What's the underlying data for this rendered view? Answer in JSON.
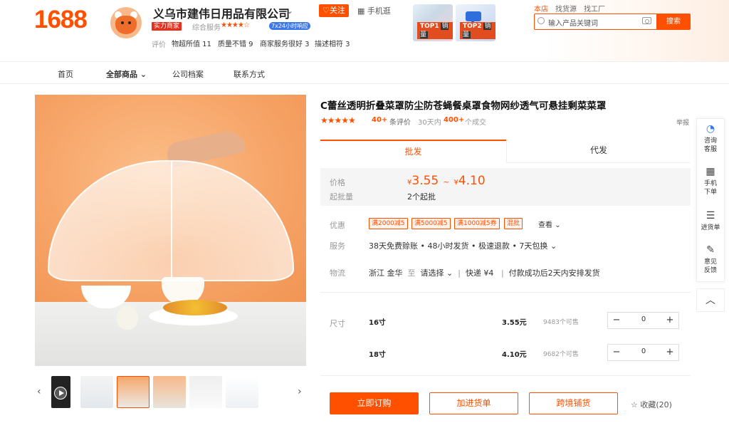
{
  "header": {
    "logo": "1688",
    "company_name": "义乌市建伟日用品有限公司",
    "follow_label": "♡关注",
    "mobile_link": "手机逛",
    "badge_strength": "实力商家",
    "service_label": "综合服务",
    "service_score": "4.5",
    "badge_24h": "7x24小时响应",
    "eval_label": "评价",
    "eval_items": [
      "物超所值 11",
      "质量不错 9",
      "商家服务很好 3",
      "描述相符 3"
    ],
    "top_products": [
      {
        "rank": "TOP1",
        "label": "销量"
      },
      {
        "rank": "TOP2",
        "label": "销量"
      }
    ],
    "search": {
      "scope_tabs": [
        "本店",
        "找货源",
        "找工厂"
      ],
      "active_scope": "本店",
      "placeholder": "输入产品关键词",
      "button": "搜索"
    }
  },
  "nav": {
    "items": [
      "首页",
      "全部商品",
      "公司档案",
      "联系方式"
    ]
  },
  "product": {
    "title": "C蕾丝透明折叠菜罩防尘防苍蝇餐桌罩食物网纱透气可悬挂剩菜菜罩",
    "rating_stars": "★★★★★",
    "rating_count": "40+",
    "rating_text": "条评价",
    "sales_text": "30天内",
    "sales_num": "400+",
    "sales_unit": "个成交",
    "report": "举报",
    "tabs": [
      "批发",
      "代发"
    ],
    "price_label": "价格",
    "currency": "¥",
    "price_min": "3.55",
    "price_max": "4.10",
    "moq_label": "起批量",
    "moq_value": "2个起批",
    "promo_label": "优惠",
    "promos": [
      "满2000减5",
      "满5000减5",
      "满1000减5券",
      "混批"
    ],
    "view_more": "查看",
    "service_label": "服务",
    "service_text": "38天免费赊账 • 48小时发货 • 极速退款 • 7天包换",
    "logistics_label": "物流",
    "logistics_from": "浙江 金华",
    "logistics_to_word": "至",
    "logistics_select": "请选择",
    "logistics_express": "快递 ¥4",
    "logistics_note": "付款成功后2天内安排发货",
    "size_label": "尺寸",
    "skus": [
      {
        "name": "16寸",
        "price": "3.55元",
        "stock": "9483个可售",
        "qty": "0"
      },
      {
        "name": "18寸",
        "price": "4.10元",
        "stock": "9682个可售",
        "qty": "0"
      }
    ],
    "buttons": {
      "buy": "立即订购",
      "cart": "加进货单",
      "cross": "跨境铺货",
      "favorite": "☆ 收藏(20)"
    }
  },
  "sidebar": {
    "items": [
      {
        "label1": "咨询",
        "label2": "客服",
        "icon": "chat-icon"
      },
      {
        "label1": "手机",
        "label2": "下单",
        "icon": "qr-icon"
      },
      {
        "label1": "进货单",
        "label2": "",
        "icon": "list-icon"
      },
      {
        "label1": "意见",
        "label2": "反馈",
        "icon": "edit-icon"
      }
    ],
    "top_icon": "chevron-up-icon"
  },
  "colors": {
    "accent": "#ff5000",
    "badge_red": "#e62e1a",
    "badge_blue": "#3d78e8"
  }
}
